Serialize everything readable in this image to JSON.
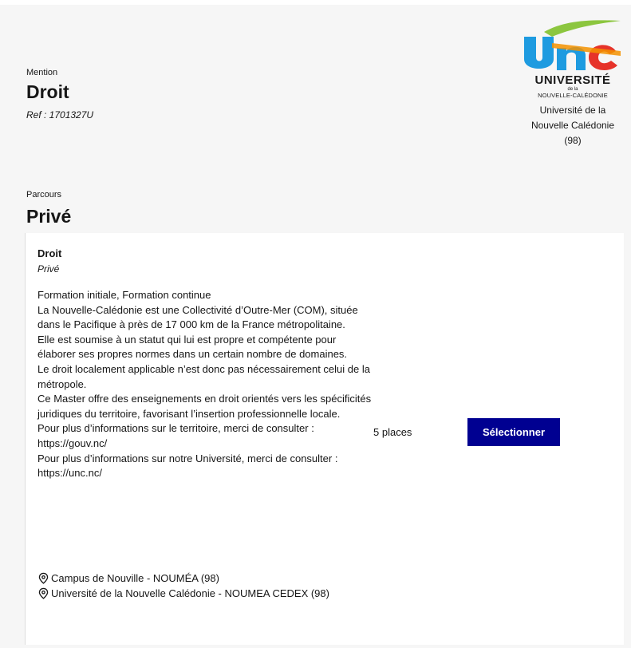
{
  "mention": {
    "label": "Mention",
    "title": "Droit",
    "ref": "Ref : 1701327U"
  },
  "logo": {
    "univ": "UNIVERSITÉ",
    "dela": "de la",
    "nc": "NOUVELLE-CALÉDONIE",
    "colors": {
      "blue": "#1e9be0",
      "orange": "#f39200",
      "green": "#8cc63f"
    }
  },
  "etablissement": {
    "line1": "Université de la",
    "line2": "Nouvelle Calédonie",
    "line3": "(98)"
  },
  "parcours": {
    "label": "Parcours",
    "title": "Privé"
  },
  "formation": {
    "title": "Droit",
    "subtitle": "Privé",
    "description": [
      "Formation initiale, Formation continue",
      "La Nouvelle-Calédonie est une Collectivité d’Outre-Mer (COM), située dans le Pacifique à près de 17 000 km de la France métropolitaine.",
      "Elle est soumise à un statut qui lui est propre et compétente pour élaborer ses propres normes dans un certain nombre de domaines.",
      "Le droit localement applicable n’est donc pas nécessairement celui de la métropole.",
      "Ce Master offre des enseignements en droit orientés vers les spécificités juridiques du territoire, favorisant l’insertion professionnelle locale.",
      "Pour plus d’informations sur le territoire, merci de consulter : https://gouv.nc/",
      "Pour plus d’informations sur notre Université, merci de consulter : https://unc.nc/"
    ],
    "places": "5 places",
    "select_label": "Sélectionner",
    "locations": [
      "Campus de Nouville - NOUMÉA (98)",
      "Université de la Nouvelle Calédonie - NOUMEA CEDEX (98)"
    ]
  },
  "colors": {
    "button_bg": "#000091",
    "panel_bg": "#f6f6f6",
    "text": "#161616"
  }
}
